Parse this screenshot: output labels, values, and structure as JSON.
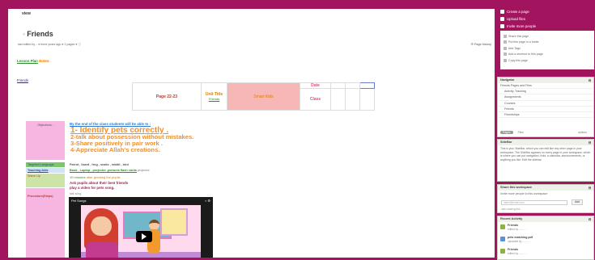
{
  "tabs": [
    "view",
    "edit"
  ],
  "page": {
    "title": "Friends",
    "meta": "last edited by ..  ● three years ago   ●  2 pages   ●  ⓘ",
    "history_label": "Page history"
  },
  "lesson_links": {
    "lesson_plan": "Lesson Plan",
    "notes": "Notes:"
  },
  "friends_link": "Friends",
  "header_table": {
    "page": "Page 22-23",
    "unit_title": "Unit Title",
    "unit_sub": "Friends",
    "brand": "Smart Kids",
    "date_label": "Date",
    "class_label": "Class"
  },
  "objectives": {
    "label": "Objectives :",
    "intro": "By the end of the class students will be able to :",
    "items": [
      "1- Identify pets correctly .",
      "2-talk about possession without mistakes.",
      "3-Share positively in pair work .",
      "4-Appreciate Allah's creations."
    ]
  },
  "rows": {
    "targeted_language_label": "Targeted Language",
    "targeted_language": "Parrot , lizard , frog , snake , rabbit , bird",
    "teaching_aids_label": "Teaching Aids",
    "teaching_aids_links": "Book , Laptop , projector ,pictures flash cards",
    "teaching_aids_extra": "projector",
    "warm_up_label": "Warm Up",
    "warm_up_pre": "10 minutes",
    "warm_up_1": "after greeting the pupils",
    "warm_up_2": "Ask pupils about their best friends",
    "warm_up_3": "play a video for pets song.",
    "procedure_label": "Procedure(Steps)",
    "talk_song": "talk song"
  },
  "video": {
    "title": "Pet Songs",
    "controls": "< ⚙"
  },
  "top_menu": [
    "Create a page",
    "Upload files",
    "Invite more people"
  ],
  "actions": [
    "Share this page",
    "Put this page in a folder",
    "Add Tags",
    "Add a shortcut to this page",
    "Copy this page"
  ],
  "navigator": {
    "title": "Navigator",
    "items": [
      "Friends  Pages and Files",
      "Activity, Tracking",
      "Assignments",
      "Courses",
      "Friends",
      "Friendships"
    ],
    "footer": [
      "Pages",
      "Files",
      "options"
    ]
  },
  "sidebar_box": {
    "title": "SideBar",
    "text": "This is your SideBar, which you can edit like any other page in your workspace. The SideBar appears on every page in your workspace, which is where you can put navigation, links, a calendar, announcements, or anything you like. Edit the sidebar"
  },
  "share_box": {
    "title": "Share this workspace",
    "text": "Invite more people to this workspace",
    "input_placeholder": "name@email.com",
    "button": "Add",
    "link": "user-sharing-link"
  },
  "recent": {
    "title": "Recent Activity",
    "items": [
      {
        "title": "Friends",
        "sub": "edited by ........ .."
      },
      {
        "title": "pets matching.pdf",
        "sub": "uploaded by ........ .."
      },
      {
        "title": "Friends",
        "sub": "edited by ........ .."
      }
    ]
  }
}
